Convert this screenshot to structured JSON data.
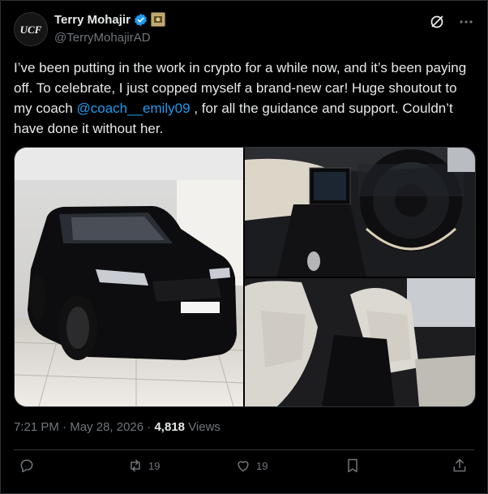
{
  "author": {
    "name": "Terry Mohajir",
    "handle": "@TerryMohajirAD",
    "avatar_text": "UCF"
  },
  "tweet": {
    "text_before": "I’ve been putting in the work in crypto for a while now, and it’s been paying off. To celebrate, I just copped myself a brand-new car! Huge shoutout to my coach ",
    "mention": "@coach__emily09",
    "text_after": " , for all the guidance and support. Couldn’t have done it without her."
  },
  "meta": {
    "time": "7:21 PM",
    "sep": "·",
    "date": "May 28, 2026",
    "views_count": "4,818",
    "views_label": "Views"
  },
  "actions": {
    "reply_count": "",
    "retweet_count": "19",
    "like_count": "19"
  },
  "colors": {
    "accent": "#1d9bf0",
    "muted": "#71767b",
    "verified": "#1d9bf0"
  }
}
